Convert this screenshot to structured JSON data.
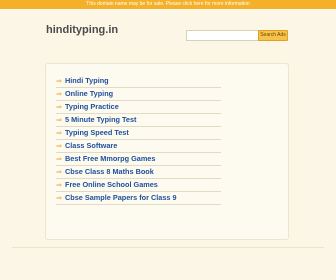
{
  "banner": {
    "text": "This domain name may be for sale. Please click here for more information"
  },
  "header": {
    "site_title": "hindityping.in"
  },
  "search": {
    "placeholder": "",
    "button_label": "Search Ads"
  },
  "links": {
    "items": [
      {
        "label": "Hindi Typing"
      },
      {
        "label": "Online Typing"
      },
      {
        "label": "Typing Practice"
      },
      {
        "label": "5 Minute Typing Test"
      },
      {
        "label": "Typing Speed Test"
      },
      {
        "label": "Class Software"
      },
      {
        "label": "Best Free Mmorpg Games"
      },
      {
        "label": "Cbse Class 8 Maths Book"
      },
      {
        "label": "Free Online School Games"
      },
      {
        "label": "Cbse Sample Papers for Class 9"
      }
    ]
  },
  "colors": {
    "banner": "#f3b028",
    "link": "#1f4f9a",
    "arrow": "#f0a830",
    "background": "#fbf6e6"
  },
  "icons": {
    "arrow": "right-arrow-icon"
  }
}
